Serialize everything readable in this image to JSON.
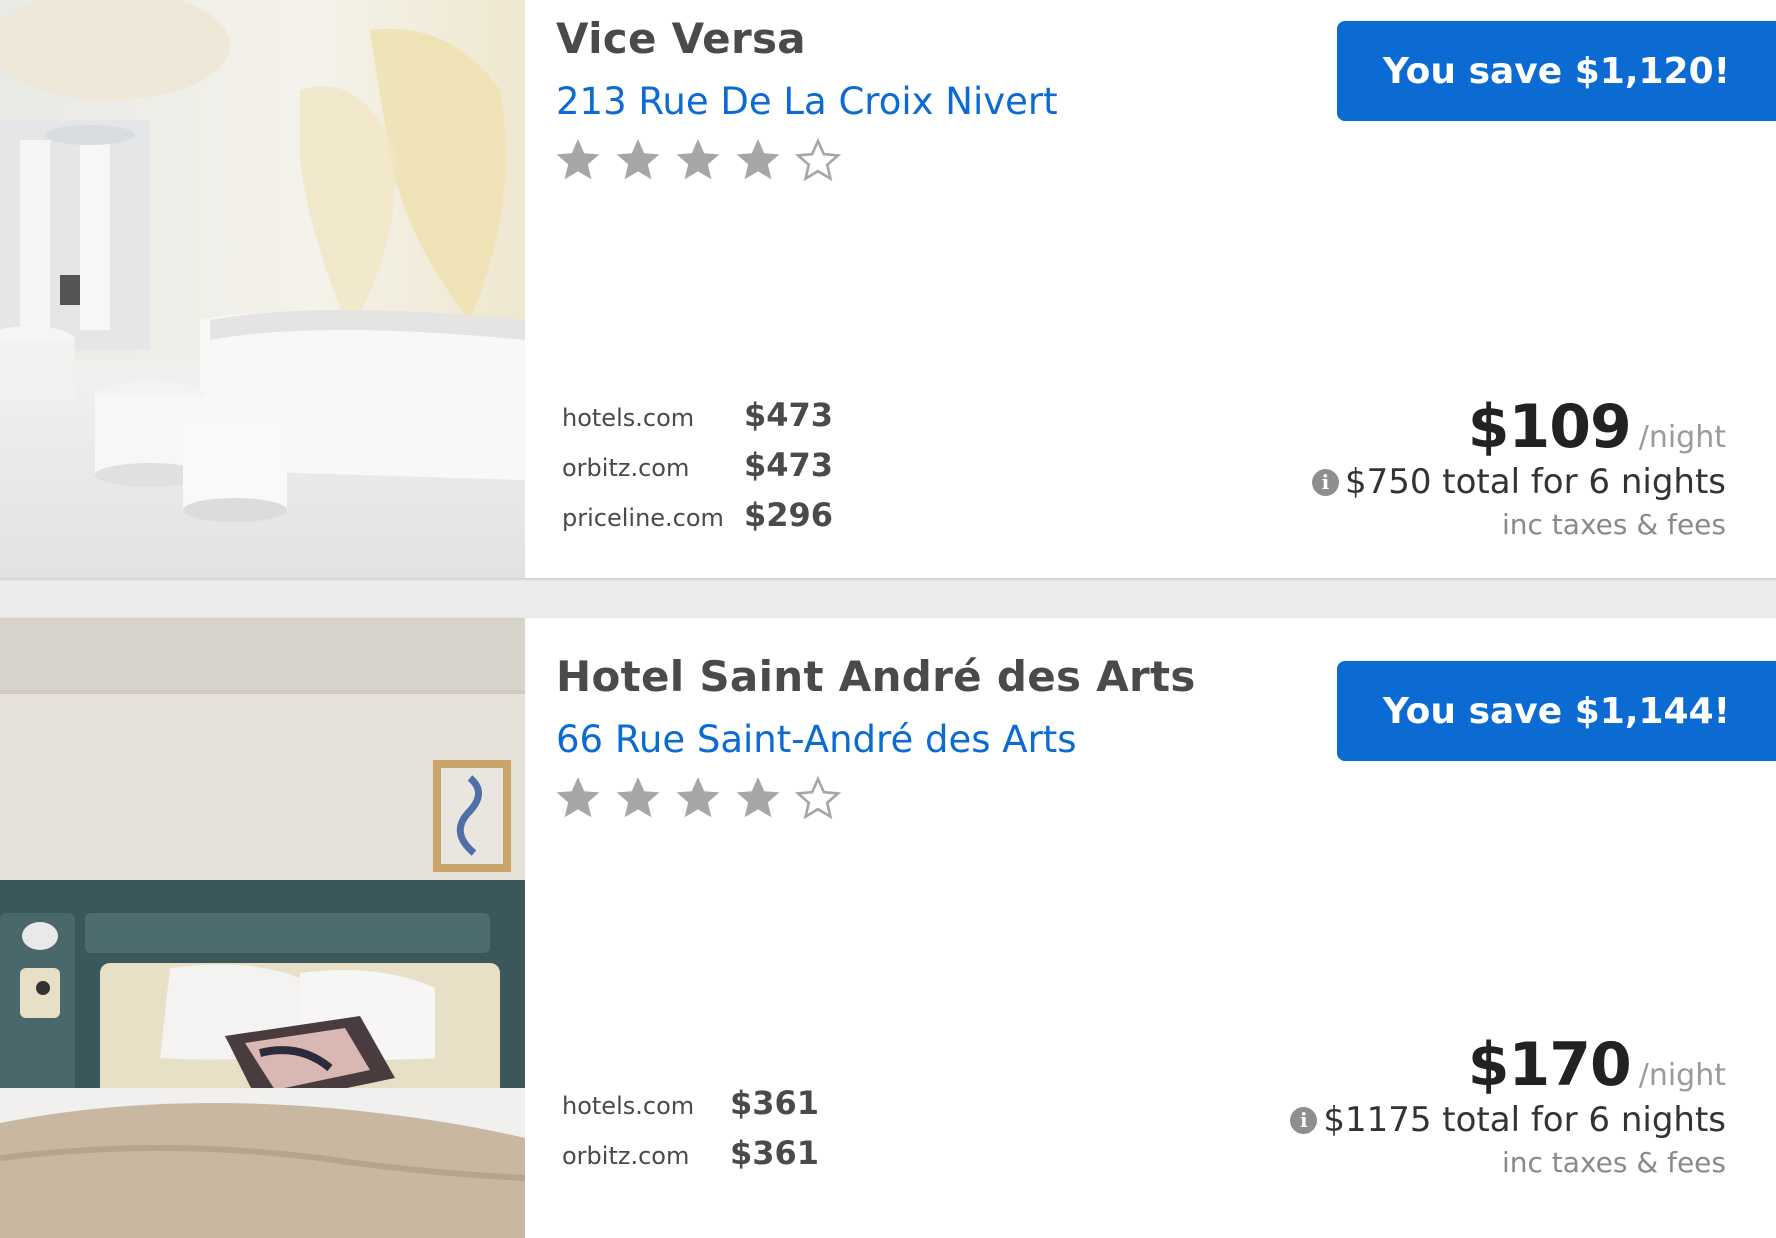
{
  "hotels": [
    {
      "name": "Vice Versa",
      "address": "213 Rue De La Croix Nivert",
      "stars": 4,
      "star_max": 5,
      "savings_label": "You save $1,120!",
      "sites": [
        {
          "site": "hotels.com",
          "price": "$473"
        },
        {
          "site": "orbitz.com",
          "price": "$473"
        },
        {
          "site": "priceline.com",
          "price": "$296"
        }
      ],
      "price": "$109",
      "per_night": "/night",
      "info_icon": "i",
      "total": "$750 total for 6 nights",
      "fees": "inc taxes & fees",
      "image": "white-lobby-photo"
    },
    {
      "name": "Hotel Saint André des Arts",
      "address": "66 Rue Saint-André des Arts",
      "stars": 4,
      "star_max": 5,
      "savings_label": "You save $1,144!",
      "sites": [
        {
          "site": "hotels.com",
          "price": "$361"
        },
        {
          "site": "orbitz.com",
          "price": "$361"
        }
      ],
      "price": "$170",
      "per_night": "/night",
      "info_icon": "i",
      "total": "$1175 total for 6 nights",
      "fees": "inc taxes & fees",
      "image": "bedroom-photo"
    }
  ],
  "colors": {
    "accent": "#0b6bd3",
    "star_filled": "#a6a6a6",
    "text": "#4a4a4a",
    "muted": "#9b9b9b"
  },
  "icons": {
    "star_filled": "star-filled-icon",
    "star_empty": "star-empty-icon",
    "info": "info-icon"
  }
}
